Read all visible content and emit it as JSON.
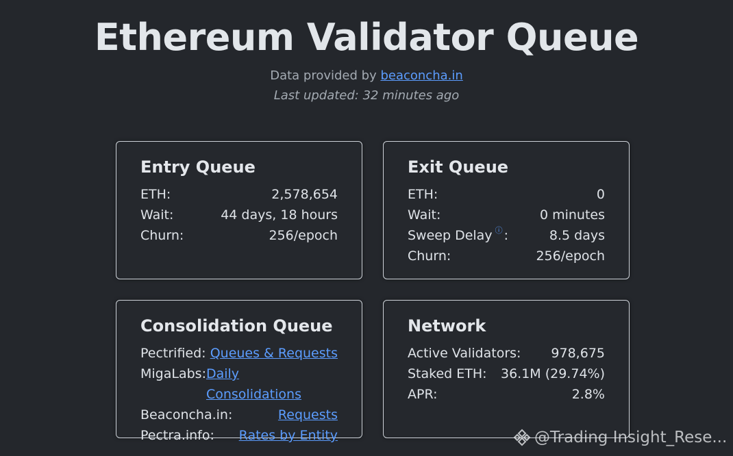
{
  "header": {
    "title": "Ethereum Validator Queue",
    "provided_prefix": "Data provided by ",
    "provided_link": "beaconcha.in",
    "last_updated": "Last updated: 32 minutes ago"
  },
  "entry_queue": {
    "title": "Entry Queue",
    "rows": [
      {
        "label": "ETH:",
        "value": "2,578,654"
      },
      {
        "label": "Wait:",
        "value": "44 days, 18 hours"
      },
      {
        "label": "Churn:",
        "value": "256/epoch"
      }
    ]
  },
  "exit_queue": {
    "title": "Exit Queue",
    "rows": [
      {
        "label": "ETH:",
        "value": "0"
      },
      {
        "label": "Wait:",
        "value": "0 minutes"
      },
      {
        "label": "Sweep Delay",
        "label_suffix": ":",
        "value": "8.5 days"
      },
      {
        "label": "Churn:",
        "value": "256/epoch"
      }
    ],
    "info_glyph": "ⓘ"
  },
  "consolidation_queue": {
    "title": "Consolidation Queue",
    "rows": [
      {
        "label": "Pectrified:",
        "link": "Queues & Requests"
      },
      {
        "label": "MigaLabs:",
        "link": "Daily Consolidations"
      },
      {
        "label": "Beaconcha.in:",
        "link": "Requests"
      },
      {
        "label": "Pectra.info:",
        "link": "Rates by Entity"
      }
    ]
  },
  "network": {
    "title": "Network",
    "rows": [
      {
        "label": "Active Validators:",
        "value": "978,675"
      },
      {
        "label": "Staked ETH:",
        "value": "36.1M (29.74%)"
      },
      {
        "label": "APR:",
        "value": "2.8%"
      }
    ]
  },
  "watermark": {
    "icon": "binance-diamond-icon",
    "text": "@Trading Insight_Rese..."
  },
  "colors": {
    "background": "#24272c",
    "link": "#5c9dff",
    "card_border": "#cfd4da"
  }
}
